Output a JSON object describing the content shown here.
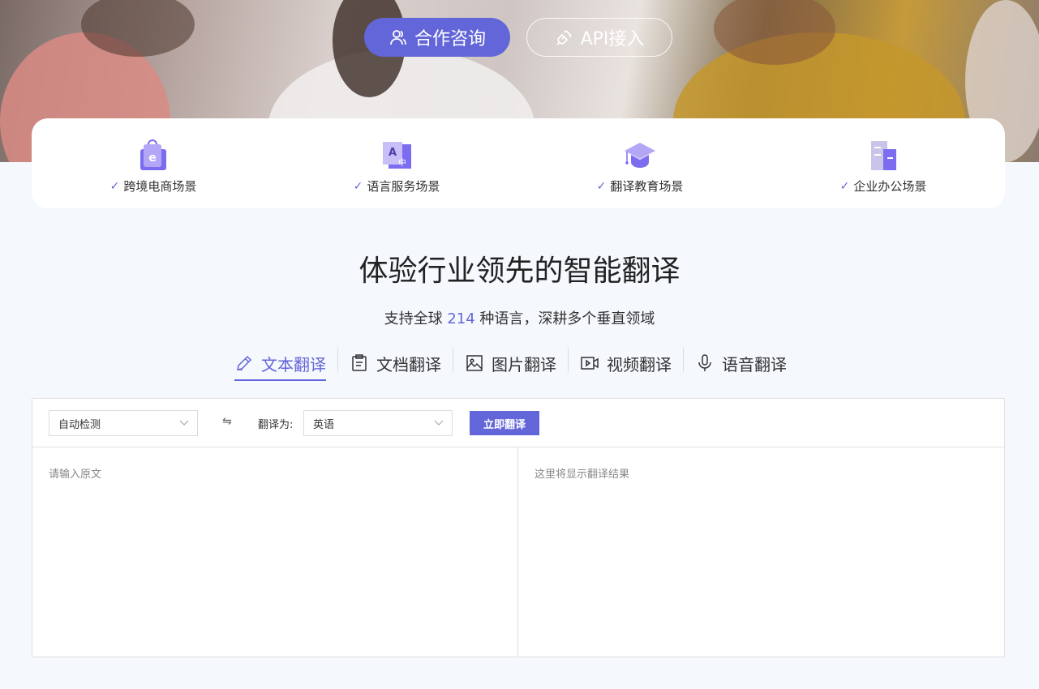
{
  "hero": {
    "consult_label": "合作咨询",
    "api_label": "API接入"
  },
  "scenes": [
    {
      "label": "跨境电商场景",
      "icon": "shopping-bag-icon"
    },
    {
      "label": "语言服务场景",
      "icon": "translate-icon"
    },
    {
      "label": "翻译教育场景",
      "icon": "graduation-cap-icon"
    },
    {
      "label": "企业办公场景",
      "icon": "office-building-icon"
    }
  ],
  "heading": {
    "title": "体验行业领先的智能翻译",
    "subtitle_pre": "支持全球 ",
    "subtitle_num": "214",
    "subtitle_post": " 种语言，深耕多个垂直领域"
  },
  "tabs": [
    {
      "label": "文本翻译",
      "icon": "pencil-icon",
      "active": true
    },
    {
      "label": "文档翻译",
      "icon": "document-icon",
      "active": false
    },
    {
      "label": "图片翻译",
      "icon": "image-icon",
      "active": false
    },
    {
      "label": "视频翻译",
      "icon": "video-icon",
      "active": false
    },
    {
      "label": "语音翻译",
      "icon": "microphone-icon",
      "active": false
    }
  ],
  "translator": {
    "source_lang": "自动检测",
    "swap_symbol": "⇋",
    "to_label": "翻译为:",
    "target_lang": "英语",
    "translate_button": "立即翻译",
    "input_placeholder": "请输入原文",
    "output_placeholder": "这里将显示翻译结果"
  },
  "colors": {
    "accent": "#6366d8",
    "page_bg": "#f5f8fd"
  }
}
